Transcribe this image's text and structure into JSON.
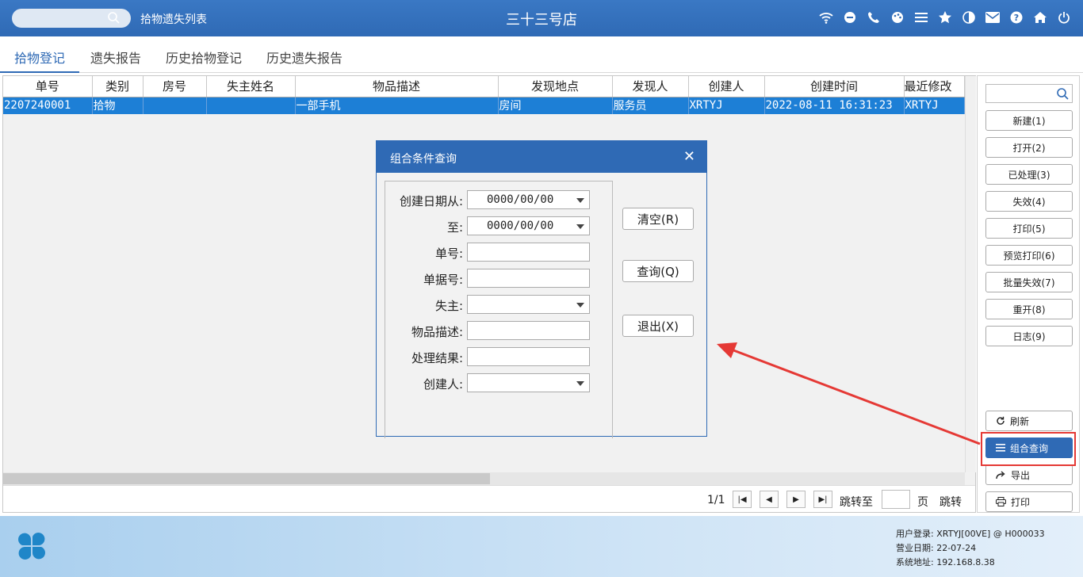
{
  "titlebar": {
    "window_title": "拾物遗失列表",
    "hotel_name": "三十三号店",
    "icons": [
      "wifi-icon",
      "chat-icon",
      "phone-icon",
      "palette-icon",
      "menu-icon",
      "star-icon",
      "contrast-icon",
      "mail-icon",
      "help-icon",
      "home-icon",
      "power-icon"
    ]
  },
  "tabs": [
    {
      "label": "拾物登记",
      "active": true
    },
    {
      "label": "遗失报告"
    },
    {
      "label": "历史拾物登记"
    },
    {
      "label": "历史遗失报告"
    }
  ],
  "table": {
    "columns": [
      "单号",
      "类别",
      "房号",
      "失主姓名",
      "物品描述",
      "发现地点",
      "发现人",
      "创建人",
      "创建时间",
      "最近修改"
    ],
    "rows": [
      [
        "2207240001",
        "拾物",
        "",
        "",
        "一部手机",
        "房间",
        "服务员",
        "XRTYJ",
        "2022-08-11 16:31:23",
        "XRTYJ"
      ]
    ]
  },
  "pager": {
    "page": "1/1",
    "jump_to": "跳转至",
    "page_unit": "页",
    "jump_button": "跳转"
  },
  "sidebar": {
    "buttons": [
      "新建(1)",
      "打开(2)",
      "已处理(3)",
      "失效(4)",
      "打印(5)",
      "预览打印(6)",
      "批量失效(7)",
      "重开(8)",
      "日志(9)"
    ],
    "bottom": [
      {
        "label": "刷新",
        "icon": "refresh-icon"
      },
      {
        "label": "组合查询",
        "icon": "list-icon"
      },
      {
        "label": "导出",
        "icon": "export-icon"
      },
      {
        "label": "打印",
        "icon": "printer-icon"
      }
    ]
  },
  "dialog": {
    "title": "组合条件查询",
    "fields": [
      {
        "label": "创建日期从:",
        "value": "0000/00/00",
        "dropdown": true
      },
      {
        "label": "至:",
        "value": "0000/00/00",
        "dropdown": true
      },
      {
        "label": "单号:",
        "value": "",
        "dropdown": false
      },
      {
        "label": "单据号:",
        "value": "",
        "dropdown": false
      },
      {
        "label": "失主:",
        "value": "",
        "dropdown": true
      },
      {
        "label": "物品描述:",
        "value": "",
        "dropdown": false
      },
      {
        "label": "处理结果:",
        "value": "",
        "dropdown": false
      },
      {
        "label": "创建人:",
        "value": "",
        "dropdown": true
      }
    ],
    "buttons": [
      "清空(R)",
      "查询(Q)",
      "退出(X)"
    ]
  },
  "footer": {
    "login_label": "用户登录:",
    "login_value": "XRTYJ[00VE] @ H000033",
    "date_label": "营业日期:",
    "date_value": "22-07-24",
    "ip_label": "系统地址:",
    "ip_value": "192.168.8.38"
  },
  "colors": {
    "accent": "#2f6ab5",
    "selection": "#1d7fd6",
    "highlight_border": "#e53935"
  }
}
